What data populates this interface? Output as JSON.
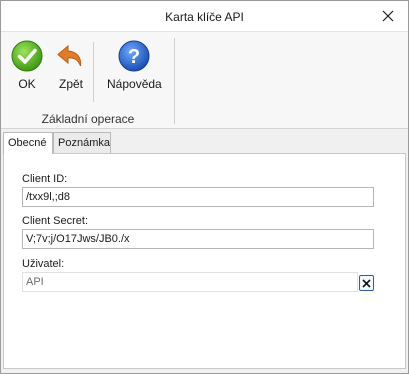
{
  "window": {
    "title": "Karta klíče API"
  },
  "ribbon": {
    "buttons": [
      {
        "label": "OK",
        "icon": "check-circle-icon",
        "color": "#4caf1f"
      },
      {
        "label": "Zpět",
        "icon": "undo-arrow-icon",
        "color": "#e07b2a"
      },
      {
        "label": "Nápověda",
        "icon": "help-circle-icon",
        "color": "#2b6fd6"
      }
    ],
    "group_label": "Základní operace"
  },
  "tabs": [
    {
      "label": "Obecné",
      "active": true
    },
    {
      "label": "Poznámka",
      "active": false
    }
  ],
  "form": {
    "client_id": {
      "label": "Client ID:",
      "value": "/txx9l,;d8"
    },
    "client_secret": {
      "label": "Client Secret:",
      "value": "V;7v;j/O17Jws/JB0./x"
    },
    "user": {
      "label": "Uživatel:",
      "value": "API"
    }
  }
}
